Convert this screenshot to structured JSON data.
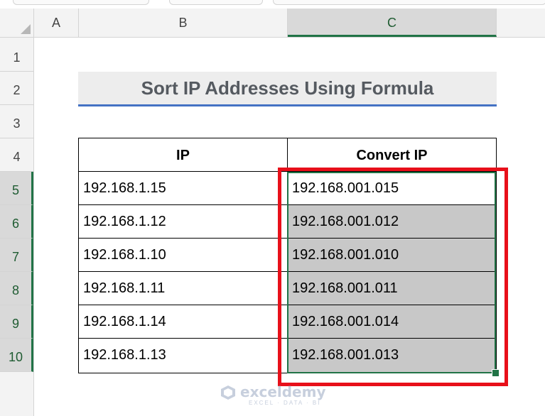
{
  "columns": [
    "A",
    "B",
    "C"
  ],
  "rows": [
    "1",
    "2",
    "3",
    "4",
    "5",
    "6",
    "7",
    "8",
    "9",
    "10"
  ],
  "title": "Sort IP Addresses Using Formula",
  "table": {
    "headers": [
      "IP",
      "Convert IP"
    ],
    "rows": [
      [
        "192.168.1.15",
        "192.168.001.015"
      ],
      [
        "192.168.1.12",
        "192.168.001.012"
      ],
      [
        "192.168.1.10",
        "192.168.001.010"
      ],
      [
        "192.168.1.11",
        "192.168.001.011"
      ],
      [
        "192.168.1.14",
        "192.168.001.014"
      ],
      [
        "192.168.1.13",
        "192.168.001.013"
      ]
    ]
  },
  "watermark": {
    "name": "exceldemy",
    "tagline": "EXCEL · DATA · BI"
  },
  "colors": {
    "selection": "#217346",
    "highlight": "#e8101a",
    "title_underline": "#4472c4"
  }
}
